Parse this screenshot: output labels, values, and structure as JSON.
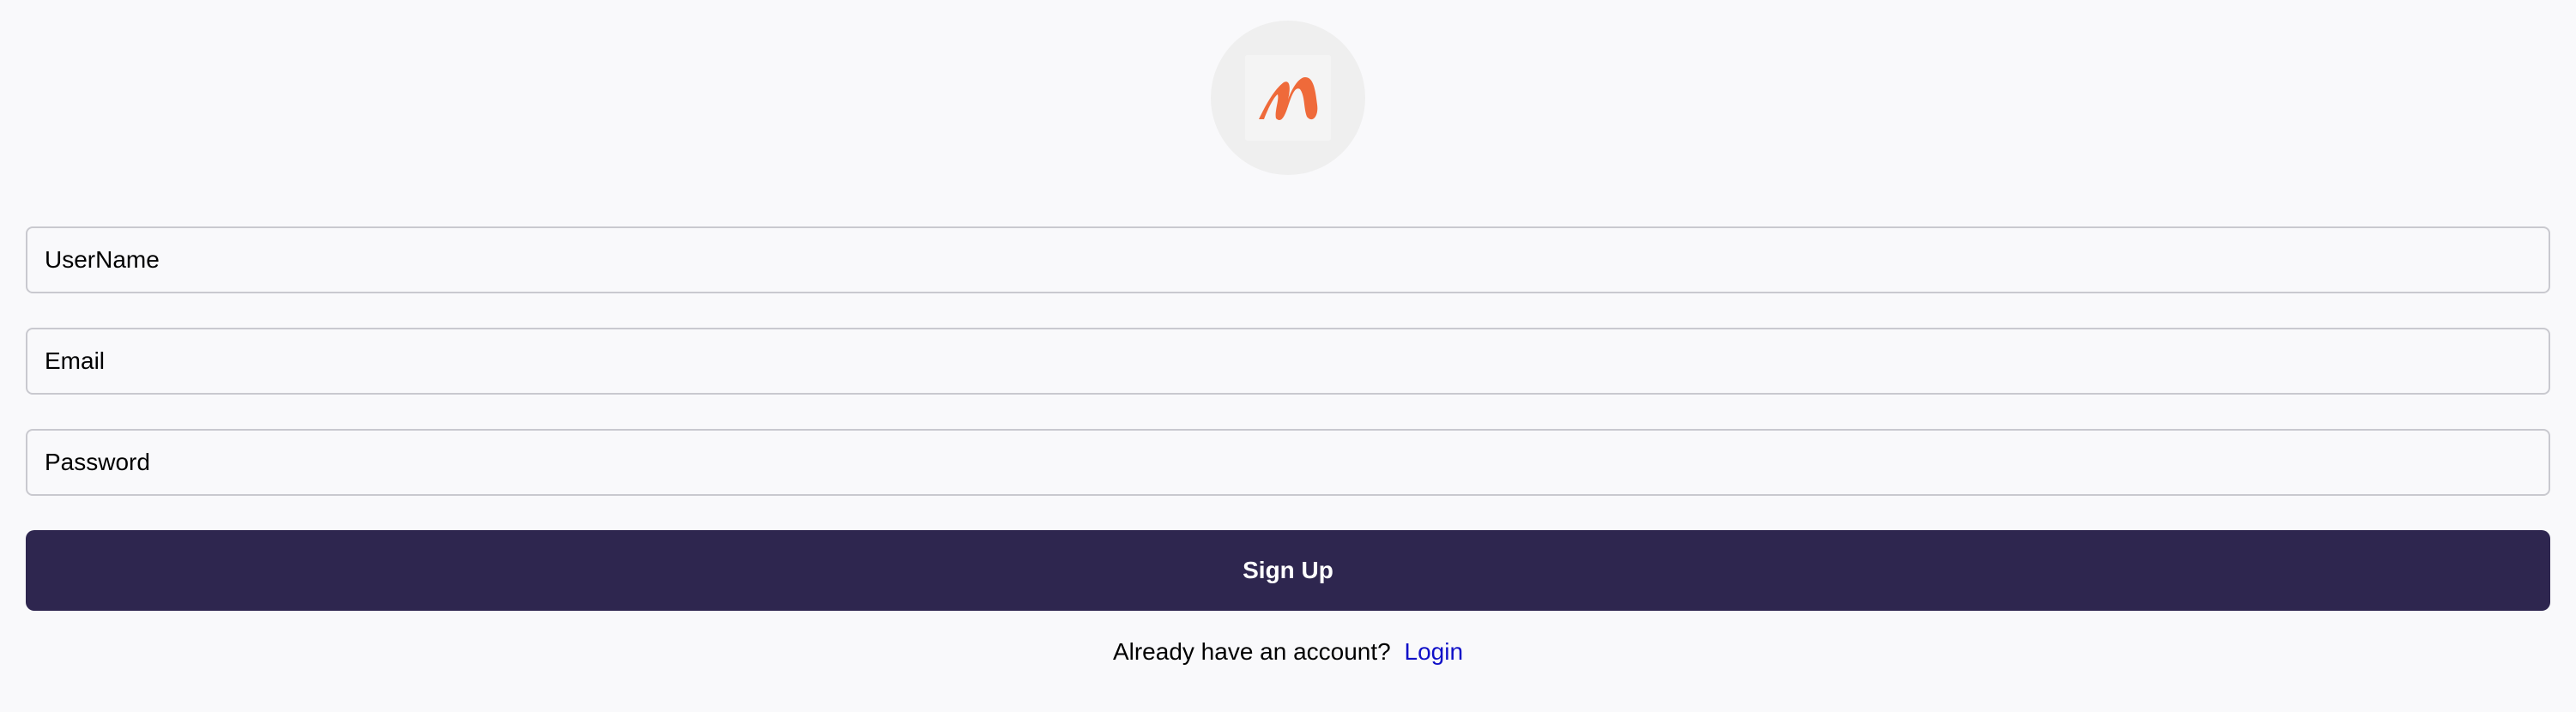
{
  "logo": {
    "icon": "brand-logo-m",
    "color": "#ef6a3a"
  },
  "form": {
    "username": {
      "placeholder": "UserName",
      "value": ""
    },
    "email": {
      "placeholder": "Email",
      "value": ""
    },
    "password": {
      "placeholder": "Password",
      "value": ""
    }
  },
  "signup_button": {
    "label": "Sign Up",
    "background": "#2e264f"
  },
  "footer": {
    "prompt": "Already have an account?",
    "login_link": "Login",
    "link_color": "#1010c8"
  }
}
